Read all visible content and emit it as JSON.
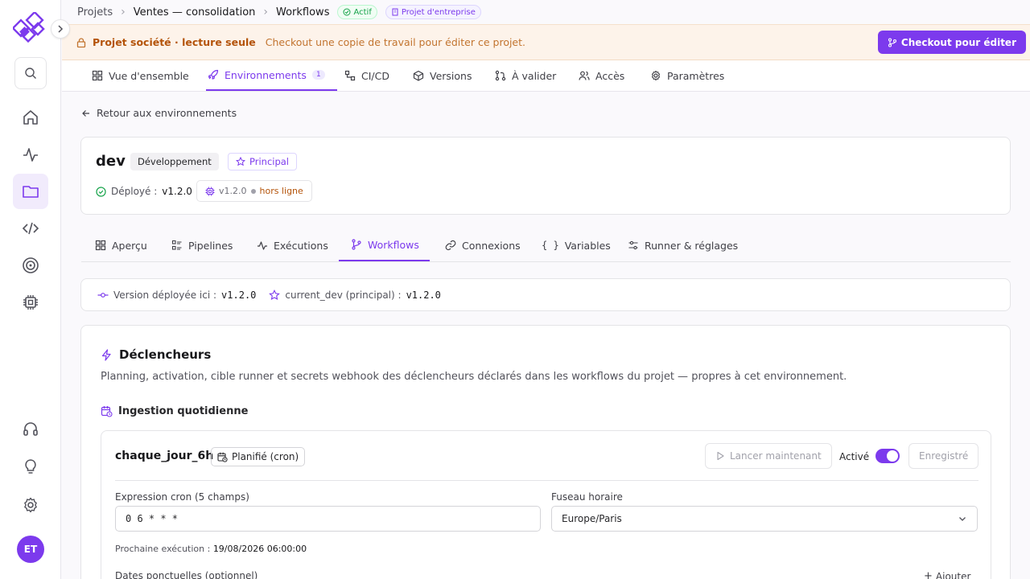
{
  "sidebar": {
    "search_icon": "search-icon",
    "items": [
      "home-icon",
      "activity-icon",
      "folder-icon",
      "code-icon",
      "target-icon",
      "chip-icon",
      "headset-icon",
      "lightbulb-icon",
      "gear-icon"
    ],
    "avatar_initials": "ET"
  },
  "breadcrumb": {
    "root": "Projets",
    "project": "Ventes — consolidation",
    "current": "Workflows",
    "status": "Actif",
    "kind": "Projet d'entreprise"
  },
  "banner": {
    "title": "Projet société · lecture seule",
    "message": "Checkout une copie de travail pour éditer ce projet.",
    "button": "Checkout pour éditer"
  },
  "project_tabs": [
    {
      "label": "Vue d'ensemble"
    },
    {
      "label": "Environnements",
      "count": "1"
    },
    {
      "label": "CI/CD"
    },
    {
      "label": "Versions"
    },
    {
      "label": "À valider"
    },
    {
      "label": "Accès"
    },
    {
      "label": "Paramètres"
    }
  ],
  "back_link": "Retour aux environnements",
  "environment": {
    "name": "dev",
    "type": "Développement",
    "primary": "Principal",
    "deployed_label": "Déployé :",
    "deployed_version": "v1.2.0",
    "runner_version": "v1.2.0",
    "runner_status": "hors ligne"
  },
  "env_tabs": [
    {
      "label": "Aperçu"
    },
    {
      "label": "Pipelines"
    },
    {
      "label": "Exécutions"
    },
    {
      "label": "Workflows"
    },
    {
      "label": "Connexions"
    },
    {
      "label": "Variables"
    },
    {
      "label": "Runner & réglages"
    }
  ],
  "version_bar": {
    "deployed_label": "Version déployée ici :",
    "deployed_value": "v1.2.0",
    "branch_label": "current_dev (principal) :",
    "branch_value": "v1.2.0"
  },
  "triggers": {
    "title": "Déclencheurs",
    "description": "Planning, activation, cible runner et secrets webhook des déclencheurs déclarés dans les workflows du projet — propres à cet environnement.",
    "workflow_name": "Ingestion quotidienne",
    "trigger": {
      "name": "chaque_jour_6h",
      "type": "Planifié (cron)",
      "run_now": "Lancer maintenant",
      "active_label": "Activé",
      "active": true,
      "saved": "Enregistré",
      "cron_label": "Expression cron (5 champs)",
      "cron_value": "0 6 * * *",
      "tz_label": "Fuseau horaire",
      "tz_value": "Europe/Paris",
      "next_label": "Prochaine exécution :",
      "next_value": "19/08/2026 06:00:00",
      "dates_label": "Dates ponctuelles (optionnel)",
      "add_label": "Ajouter"
    }
  },
  "colors": {
    "accent": "#7c3aed",
    "warning": "#b45309",
    "success": "#16a34a"
  }
}
